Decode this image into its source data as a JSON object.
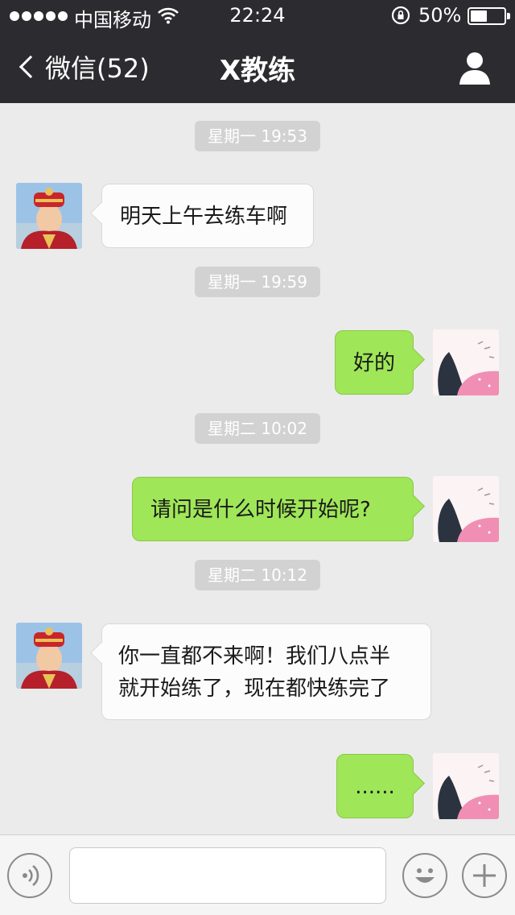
{
  "status_bar": {
    "carrier": "中国移动",
    "time": "22:24",
    "battery_percent_text": "50%",
    "battery_level": 0.5,
    "icons": [
      "signal-dots-icon",
      "wifi-icon",
      "rotation-lock-icon",
      "battery-icon"
    ]
  },
  "nav": {
    "back_label": "微信(52)",
    "title": "X教练",
    "icons": [
      "back-chevron-icon",
      "profile-icon"
    ]
  },
  "messages": [
    {
      "type": "timestamp",
      "text": "星期一 19:53"
    },
    {
      "type": "message",
      "side": "left",
      "text": "明天上午去练车啊"
    },
    {
      "type": "timestamp",
      "text": "星期一 19:59"
    },
    {
      "type": "message",
      "side": "right",
      "text": "好的"
    },
    {
      "type": "timestamp",
      "text": "星期二 10:02"
    },
    {
      "type": "message",
      "side": "right",
      "text": "请问是什么时候开始呢?"
    },
    {
      "type": "timestamp",
      "text": "星期二 10:12"
    },
    {
      "type": "message",
      "side": "left",
      "lines": [
        "你一直都不来啊！我们八点半",
        "就开始练了，现在都快练完了"
      ]
    },
    {
      "type": "message",
      "side": "right",
      "text": "......"
    }
  ],
  "input_bar": {
    "placeholder": "",
    "icons": [
      "voice-icon",
      "emoji-icon",
      "plus-icon"
    ]
  },
  "colors": {
    "header_bg": "#2c2c30",
    "chat_bg": "#ebebeb",
    "bubble_self": "#9fe658",
    "bubble_other": "#fcfcfc",
    "timestamp_bg": "#d2d2d2"
  }
}
